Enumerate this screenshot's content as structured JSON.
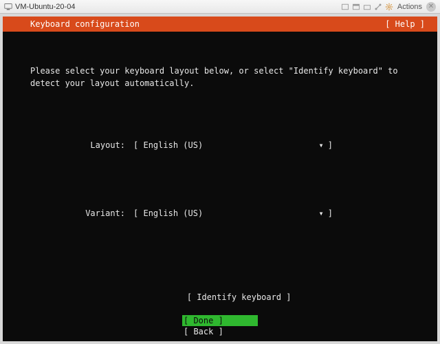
{
  "vm": {
    "title": "VM-Ubuntu-20-04",
    "actions_label": "Actions"
  },
  "header": {
    "title": "Keyboard configuration",
    "help": "[ Help ]"
  },
  "instruction": {
    "line1": "Please select your keyboard layout below, or select \"Identify keyboard\" to",
    "line2": "detect your layout automatically."
  },
  "fields": {
    "layout": {
      "label": "Layout:",
      "open": "[",
      "value": "English (US)",
      "arrow": "▾",
      "close": "]"
    },
    "variant": {
      "label": "Variant:",
      "open": "[",
      "value": "English (US)",
      "arrow": "▾",
      "close": "]"
    }
  },
  "identify": {
    "label": "[ Identify keyboard ]"
  },
  "footer": {
    "done": "[ Done        ]",
    "back": "[ Back        ]"
  }
}
